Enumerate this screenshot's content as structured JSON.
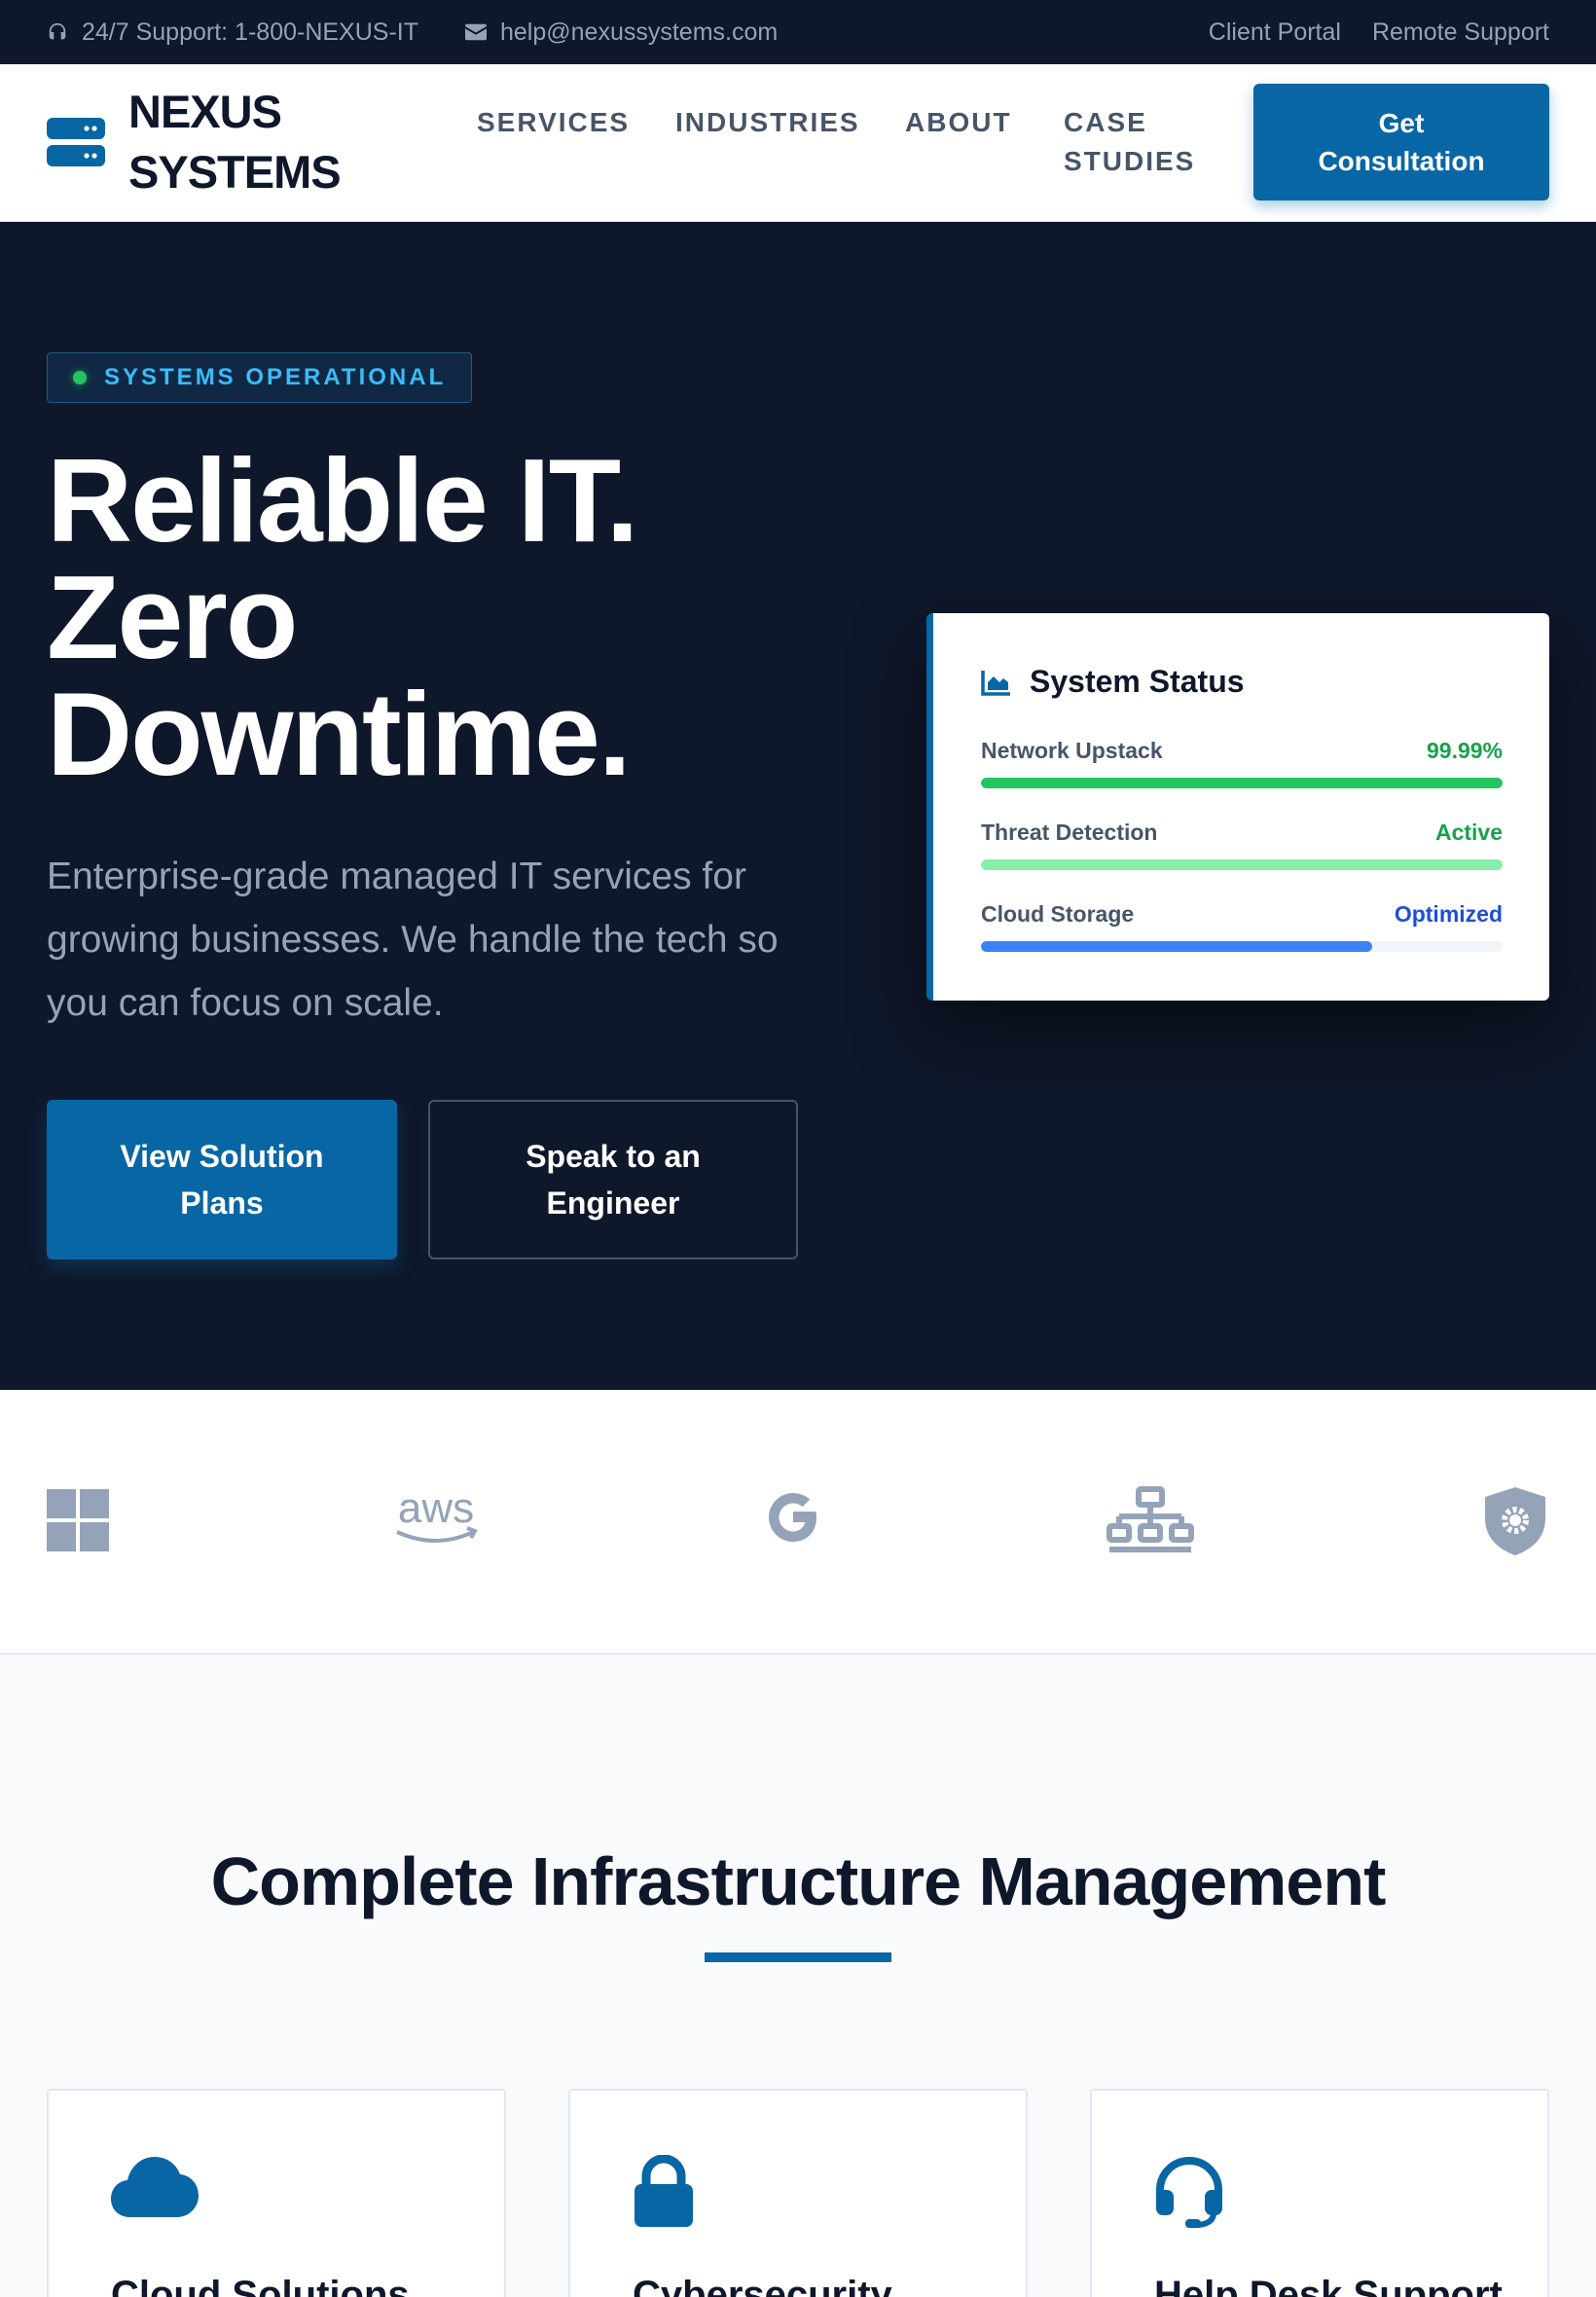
{
  "topbar": {
    "support": "24/7 Support: 1-800-NEXUS-IT",
    "email": "help@nexussystems.com",
    "links": [
      "Client Portal",
      "Remote Support"
    ]
  },
  "brand": {
    "line1": "NEXUS",
    "line2": "SYSTEMS",
    "logo_icon": "server-stack-icon"
  },
  "nav": {
    "services": "SERVICES",
    "industries": "INDUSTRIES",
    "about": "ABOUT",
    "case_line1": "CASE",
    "case_line2": "STUDIES",
    "cta_line1": "Get",
    "cta_line2": "Consultation"
  },
  "hero": {
    "badge": "SYSTEMS OPERATIONAL",
    "title_lines": [
      "Reliable IT.",
      "Zero",
      "Downtime."
    ],
    "subtitle": "Enterprise-grade managed IT services for growing businesses. We handle the tech so you can focus on scale.",
    "primary_line1": "View Solution",
    "primary_line2": "Plans",
    "secondary_line1": "Speak to an",
    "secondary_line2": "Engineer"
  },
  "status": {
    "title": "System Status",
    "icon": "area-chart-icon",
    "rows": [
      {
        "label": "Network Upstack",
        "value": "99.99%",
        "color": "#16a34a",
        "bar": "#22c55e",
        "level": 100
      },
      {
        "label": "Threat Detection",
        "value": "Active",
        "color": "#16a34a",
        "bar": "#86efac",
        "level": 100
      },
      {
        "label": "Cloud Storage",
        "value": "Optimized",
        "color": "#1d4ed8",
        "bar": "#3b82f6",
        "level": 75
      }
    ]
  },
  "partners": [
    "windows-logo-icon",
    "aws-logo-icon",
    "google-logo-icon",
    "network-icon",
    "shield-gear-icon"
  ],
  "services": {
    "title": "Complete Infrastructure Management",
    "cards": [
      {
        "icon": "cloud-icon",
        "title": "Cloud Solutions"
      },
      {
        "icon": "lock-icon",
        "title": "Cybersecurity"
      },
      {
        "icon": "headset-icon",
        "title": "Help Desk Support"
      }
    ]
  },
  "colors": {
    "navy": "#0f172a",
    "primary": "#0866a4",
    "muted": "#94a3b8",
    "success": "#22c55e"
  }
}
